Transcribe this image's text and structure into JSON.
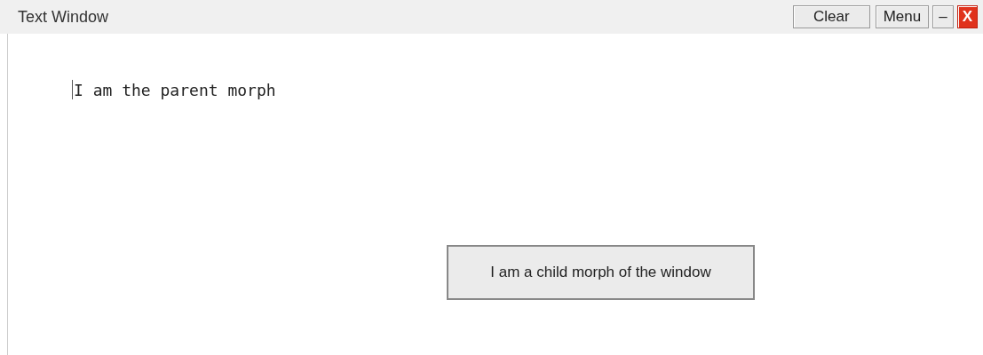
{
  "window": {
    "title": "Text Window",
    "buttons": [
      {
        "kind": "text",
        "label": "Clear"
      },
      {
        "kind": "text",
        "label": "Menu"
      },
      {
        "kind": "minimize",
        "label": "–"
      },
      {
        "kind": "close",
        "label": "X"
      }
    ]
  },
  "content": {
    "text": "I am the parent morph",
    "child_morph": {
      "text": "I am a child morph of the window"
    }
  }
}
